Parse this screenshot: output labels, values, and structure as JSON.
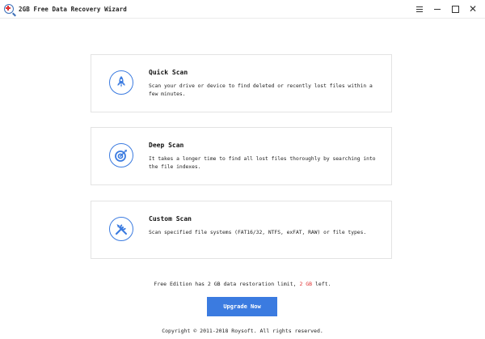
{
  "window": {
    "title": "2GB Free Data Recovery Wizard",
    "controls": {
      "menu": "menu-icon",
      "minimize": "minimize-icon",
      "maximize": "maximize-icon",
      "close": "close-icon"
    }
  },
  "scans": [
    {
      "title": "Quick Scan",
      "description": "Scan your drive or device to find deleted or recently lost files within a few minutes.",
      "icon": "rocket-icon"
    },
    {
      "title": "Deep Scan",
      "description": "It takes a longer time to find all lost files thoroughly by searching into the file indexes.",
      "icon": "target-icon"
    },
    {
      "title": "Custom Scan",
      "description": "Scan specified file systems (FAT16/32, NTFS, exFAT, RAW) or file types.",
      "icon": "tools-icon"
    }
  ],
  "limit": {
    "prefix": "Free Edition has 2 GB data restoration limit,",
    "remaining": "2 GB",
    "suffix": "left."
  },
  "upgrade_label": "Upgrade Now",
  "copyright": "Copyright © 2011-2018 Roysoft. All rights reserved.",
  "colors": {
    "accent": "#3b7be0",
    "warning": "#e03030"
  }
}
